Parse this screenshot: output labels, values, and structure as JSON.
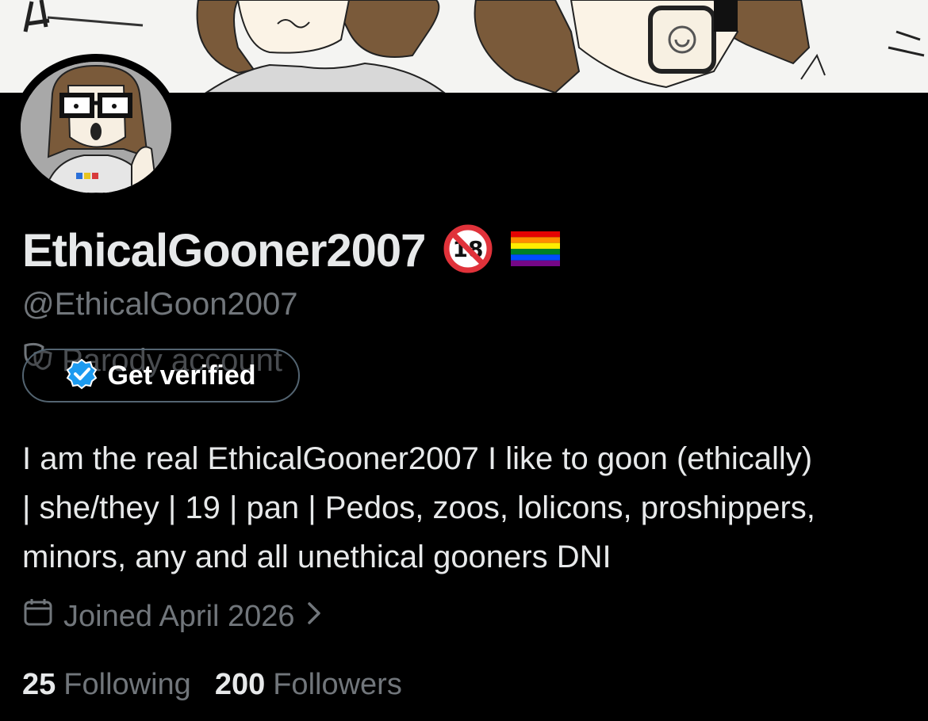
{
  "profile": {
    "display_name": "EthicalGooner2007",
    "handle": "@EthicalGoon2007",
    "parody_label": "Parody account",
    "get_verified_label": "Get verified",
    "bio_lines": [
      "I am the real EthicalGooner2007 I like to goon (ethically)",
      "| she/they | 19 | pan | Pedos, zoos, lolicons, proshippers,",
      "minors, any and all unethical gooners DNI"
    ],
    "joined": "Joined April 2026",
    "following_count": "25",
    "following_label": "Following",
    "followers_count": "200",
    "followers_label": "Followers"
  },
  "icons": {
    "no_under_18": "no-under-18-icon",
    "rainbow_flag": "rainbow-flag-icon",
    "parody": "theater-masks-icon",
    "verified": "verified-badge-icon",
    "calendar": "calendar-icon",
    "chevron": "chevron-right-icon"
  },
  "colors": {
    "background": "#000000",
    "text_primary": "#e7e9ea",
    "text_secondary": "#71767b",
    "verified_blue": "#1d9bf0",
    "no_18_red": "#e0323a"
  }
}
